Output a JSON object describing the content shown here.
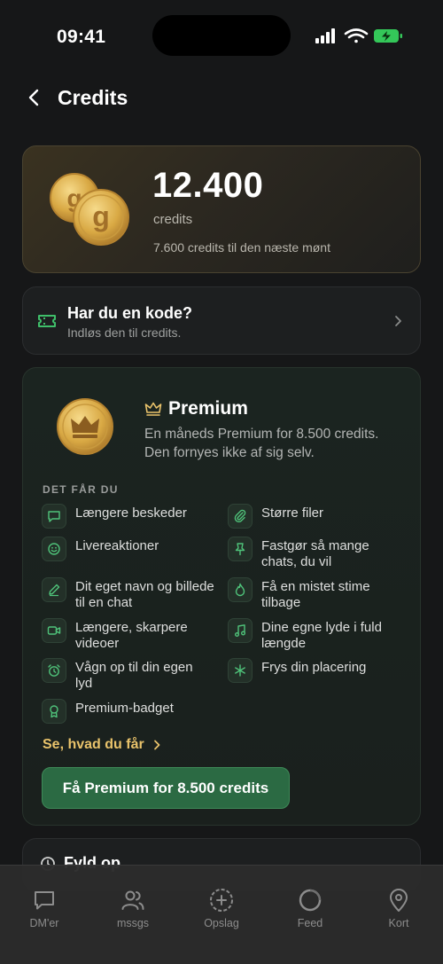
{
  "status": {
    "time": "09:41"
  },
  "header": {
    "title": "Credits"
  },
  "credits": {
    "amount": "12.400",
    "unit": "credits",
    "next_coin": "7.600 credits til den næste mønt"
  },
  "code": {
    "title": "Har du en kode?",
    "subtitle": "Indløs den til credits."
  },
  "premium": {
    "title": "Premium",
    "description": "En måneds Premium for 8.500 credits. Den fornyes ikke af sig selv.",
    "section_label": "DET FÅR DU",
    "features": [
      {
        "label": "Længere beskeder",
        "icon": "message-icon"
      },
      {
        "label": "Større filer",
        "icon": "paperclip-icon"
      },
      {
        "label": "Livereaktioner",
        "icon": "smiley-icon"
      },
      {
        "label": "Fastgør så mange chats, du vil",
        "icon": "pin-icon"
      },
      {
        "label": "Dit eget navn og billede til en chat",
        "icon": "pencil-icon"
      },
      {
        "label": "Få en mistet stime tilbage",
        "icon": "flame-icon"
      },
      {
        "label": "Længere, skarpere videoer",
        "icon": "video-icon"
      },
      {
        "label": "Dine egne lyde i fuld længde",
        "icon": "music-icon"
      },
      {
        "label": "Vågn op til din egen lyd",
        "icon": "alarm-icon"
      },
      {
        "label": "Frys din placering",
        "icon": "snowflake-icon"
      },
      {
        "label": "Premium-badget",
        "icon": "badge-icon"
      }
    ],
    "see_link": "Se, hvad du får",
    "cta": "Få Premium for 8.500 credits"
  },
  "fill": {
    "title": "Fyld op"
  },
  "tabs": [
    {
      "label": "DM'er",
      "icon": "chat-bubble-icon"
    },
    {
      "label": "mssgs",
      "icon": "people-icon"
    },
    {
      "label": "Opslag",
      "icon": "add-circle-icon"
    },
    {
      "label": "Feed",
      "icon": "circle-icon"
    },
    {
      "label": "Kort",
      "icon": "map-pin-icon"
    }
  ],
  "colors": {
    "accent_green": "#2b6a43",
    "gold": "#e9c36b",
    "background": "#161718"
  }
}
